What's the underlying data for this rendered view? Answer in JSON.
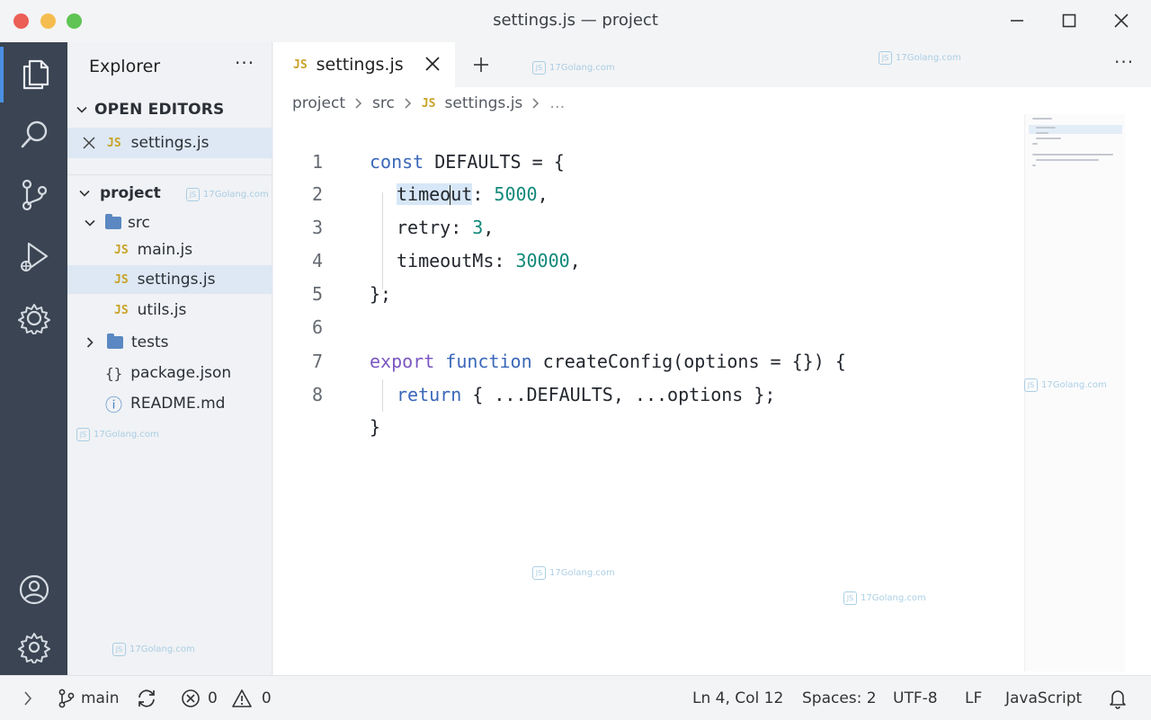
{
  "window": {
    "title": "settings.js — project"
  },
  "sidebar": {
    "title": "Explorer",
    "more": "···",
    "open_editors": {
      "label": "OPEN EDITORS",
      "items": [
        {
          "badge": "JS",
          "name": "settings.js"
        }
      ]
    },
    "tree": {
      "root": "project",
      "items": [
        {
          "type": "folder",
          "name": "src",
          "expanded": true
        },
        {
          "type": "file",
          "badge": "JS",
          "name": "main.js"
        },
        {
          "type": "file",
          "badge": "JS",
          "name": "settings.js",
          "selected": true
        },
        {
          "type": "file",
          "badge": "JS",
          "name": "utils.js"
        },
        {
          "type": "folder",
          "name": "tests",
          "expanded": false
        },
        {
          "type": "file",
          "badge": "{}",
          "name": "package.json"
        },
        {
          "type": "file",
          "badge": "ⓘ",
          "name": "README.md"
        }
      ]
    }
  },
  "editor": {
    "tabs": [
      {
        "badge": "JS",
        "label": "settings.js",
        "active": true
      }
    ],
    "more": "···",
    "breadcrumb": {
      "items": [
        "project",
        "src",
        "settings.js",
        "…"
      ],
      "file_badge": "JS"
    },
    "line_numbers": [
      "1",
      "2",
      "3",
      "4",
      "5",
      "6",
      "7",
      "8"
    ],
    "code": {
      "l1": {
        "kw": "const",
        "rest": " DEFAULTS = {"
      },
      "l2": {
        "hl_a": "timeo",
        "hl_b": "ut",
        "rest": ": ",
        "num": "5000",
        "end": ","
      },
      "l3": {
        "key": "retry: ",
        "num": "3",
        "end": ","
      },
      "l4": {
        "key": "timeoutMs: ",
        "num": "30000",
        "end": ","
      },
      "l5": {
        "text": "};"
      },
      "l7": {
        "kw1": "export",
        "kw2": "function",
        "rest": " createConfig(options = {}) {"
      },
      "l8": {
        "kw": "return",
        "rest": " { ...DEFAULTS, ...options };"
      },
      "l9": {
        "text": "}"
      }
    }
  },
  "statusbar": {
    "branch": "main",
    "errors": "0",
    "warnings": "0",
    "position": "Ln 4, Col 12",
    "spaces": "Spaces: 2",
    "encoding": "UTF-8",
    "eol": "LF",
    "language": "JavaScript"
  },
  "watermark": {
    "text": "17Golang.com",
    "box": "JS"
  },
  "colors": {
    "accent": "#4a90e2",
    "activitybar": "#3a4452",
    "js_badge": "#c9a227",
    "keyword": "#3a67b8",
    "keyword_export": "#7b57c2",
    "number": "#12897a",
    "selection": "#dde8f4"
  },
  "icons": {
    "activity": [
      "files-icon",
      "search-icon",
      "source-control-icon",
      "run-debug-icon",
      "extensions-icon",
      "account-icon",
      "settings-gear-icon"
    ],
    "window": [
      "minimize-icon",
      "maximize-icon",
      "close-icon"
    ]
  }
}
